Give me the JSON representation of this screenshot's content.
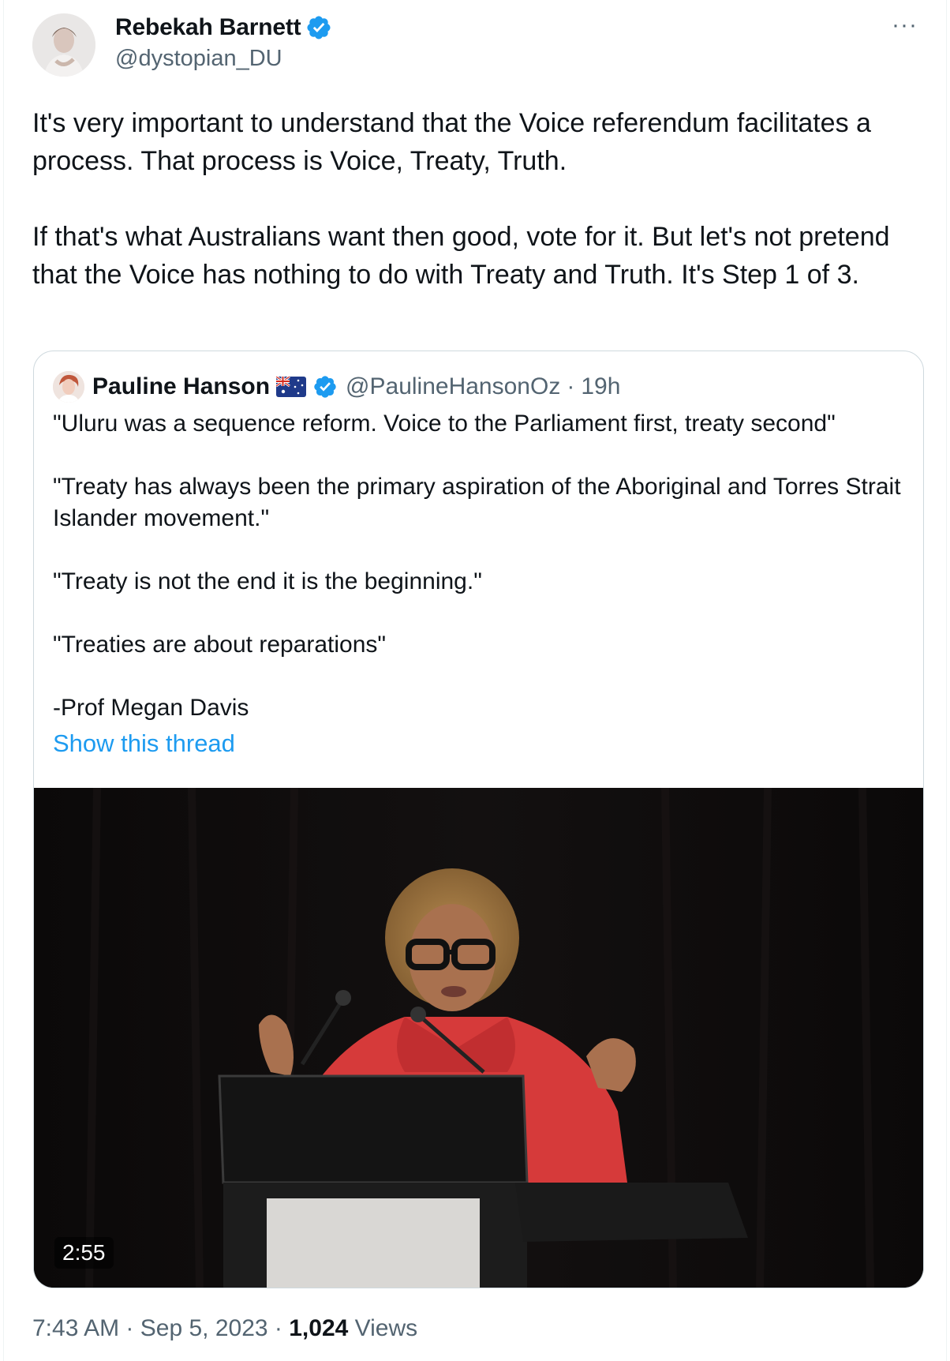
{
  "author": {
    "display_name": "Rebekah Barnett",
    "handle": "@dystopian_DU",
    "verified": true
  },
  "more_menu": "···",
  "tweet": {
    "text": "It's very important to understand that the Voice referendum facilitates a process. That process is Voice, Treaty, Truth.\n\nIf that's what Australians want then good, vote for it. But let's not pretend that the Voice has nothing to do with Treaty and Truth. It's Step 1 of 3."
  },
  "quoted": {
    "display_name": "Pauline Hanson",
    "flag_icon": "australia-flag-icon",
    "verified": true,
    "handle": "@PaulineHansonOz",
    "separator": "·",
    "time": "19h",
    "text": "\"Uluru was a sequence reform. Voice to the Parliament first, treaty second\"\n\n\"Treaty has always been the primary aspiration of the Aboriginal and Torres Strait Islander movement.\"\n\n\"Treaty is not the end it is the beginning.\"\n\n\"Treaties are about reparations\"\n\n-Prof Megan Davis",
    "show_thread": "Show this thread",
    "video_duration": "2:55"
  },
  "footer": {
    "time": "7:43 AM",
    "sep1": " · ",
    "date": "Sep 5, 2023",
    "sep2": " · ",
    "views_count": "1,024",
    "views_label": " Views"
  },
  "colors": {
    "link": "#1d9bf0",
    "secondary_text": "#536471",
    "verified_badge": "#1d9bf0"
  }
}
